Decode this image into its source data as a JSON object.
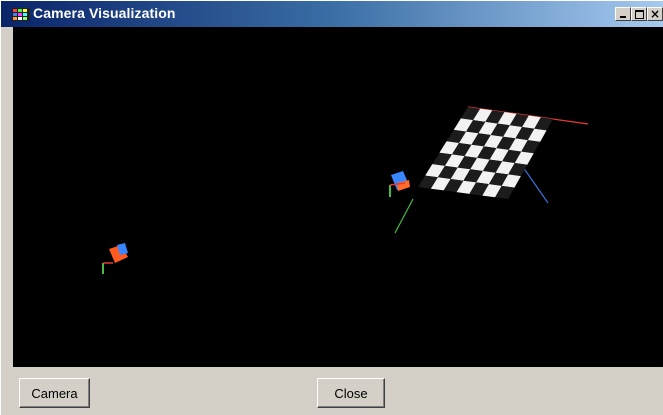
{
  "window": {
    "title": "Camera Visualization",
    "app_icon": "app-grid-icon",
    "controls": {
      "minimize_icon": "minimize-icon",
      "maximize_icon": "maximize-icon",
      "close_icon": "close-icon",
      "close_glyph": "×"
    }
  },
  "viewport": {
    "background": "#000000",
    "objects": [
      "checkerboard-target",
      "camera-1",
      "camera-2",
      "axis-lines"
    ]
  },
  "buttons": {
    "camera_label": "Camera",
    "close_label": "Close"
  },
  "colors": {
    "titlebar_start": "#0a246a",
    "titlebar_end": "#a6caf0",
    "camera_near_color": "#ff5a1f",
    "camera_far_color": "#3a86ff",
    "axis_x_color": "#e53935",
    "axis_y_color": "#43c043",
    "axis_z_color": "#3b6fd6"
  }
}
